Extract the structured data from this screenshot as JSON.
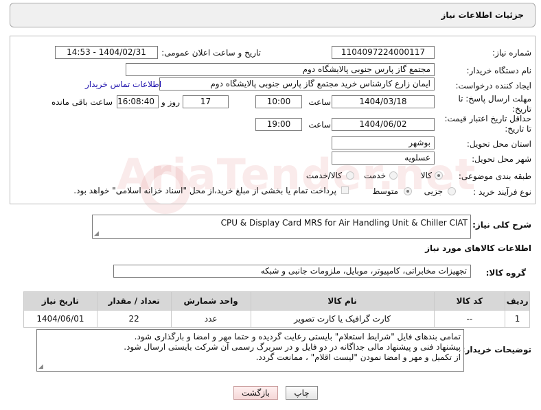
{
  "header": {
    "title": "جزئیات اطلاعات نیاز"
  },
  "form": {
    "need_number_label": "شماره نیاز:",
    "need_number": "1104097224000117",
    "announce_label": "تاریخ و ساعت اعلان عمومی:",
    "announce_value": "1404/02/31 - 14:53",
    "buyer_org_label": "نام دستگاه خریدار:",
    "buyer_org": "مجتمع گاز پارس جنوبی  پالایشگاه دوم",
    "requester_label": "ایجاد کننده درخواست:",
    "requester": "ایمان زارع کارشناس خرید مجتمع گاز پارس جنوبی  پالایشگاه دوم",
    "contact_link": "اطلاعات تماس خریدار",
    "deadline_label_1": "مهلت ارسال پاسخ: تا",
    "deadline_label_2": "تاریخ:",
    "deadline_date": "1404/03/18",
    "time_label": "ساعت",
    "deadline_time": "10:00",
    "days_value": "17",
    "days_label": "روز و",
    "remaining_time": "16:08:40",
    "remaining_label": "ساعت باقی مانده",
    "validity_label_1": "حداقل تاریخ اعتبار قیمت:",
    "validity_label_2": "تا تاریخ:",
    "validity_date": "1404/06/02",
    "validity_time": "19:00",
    "province_label": "استان محل تحویل:",
    "province": "بوشهر",
    "city_label": "شهر محل تحویل:",
    "city": "عسلویه",
    "category_label": "طبقه بندی موضوعی:",
    "category_options": [
      "کالا",
      "خدمت",
      "کالا/خدمت"
    ],
    "process_label": "نوع فرآیند خرید :",
    "process_options": [
      "جزیی",
      "متوسط"
    ],
    "payment_note": "پرداخت تمام یا بخشی از مبلغ خرید،از محل \"اسناد خزانه اسلامی\" خواهد بود."
  },
  "description": {
    "label": "شرح کلی نیاز:",
    "value": "CPU & Display Card MRS for Air Handling Unit & Chiller CIAT"
  },
  "goods": {
    "section_title": "اطلاعات کالاهای مورد نیاز",
    "group_label": "گروه کالا:",
    "group_value": "تجهیزات مخابراتی، کامپیوتر، موبایل، ملزومات جانبی و شبکه",
    "columns": [
      "ردیف",
      "کد کالا",
      "نام کالا",
      "واحد شمارش",
      "تعداد / مقدار",
      "تاریخ نیاز"
    ],
    "rows": [
      {
        "row": "1",
        "code": "--",
        "name": "کارت گرافیک یا کارت تصویر",
        "unit": "عدد",
        "qty": "22",
        "date": "1404/06/01"
      }
    ]
  },
  "notes": {
    "label": "توضیحات خریدار:",
    "lines": [
      "تمامی بندهای فایل \"شرایط استعلام\" بایستی رعایت گردیده و حتما مهر و امضا و بارگذاری شود.",
      "پیشنهاد فنی و پیشنهاد مالی جداگانه در دو فایل و در سربرگ رسمی آن شرکت بایستی ارسال شود.",
      "از تکمیل و مهر و امضا نمودن \"لیست اقلام\" ، ممانعت گردد."
    ]
  },
  "buttons": {
    "print": "چاپ",
    "back": "بازگشت"
  },
  "watermark": "AriaTender.net"
}
